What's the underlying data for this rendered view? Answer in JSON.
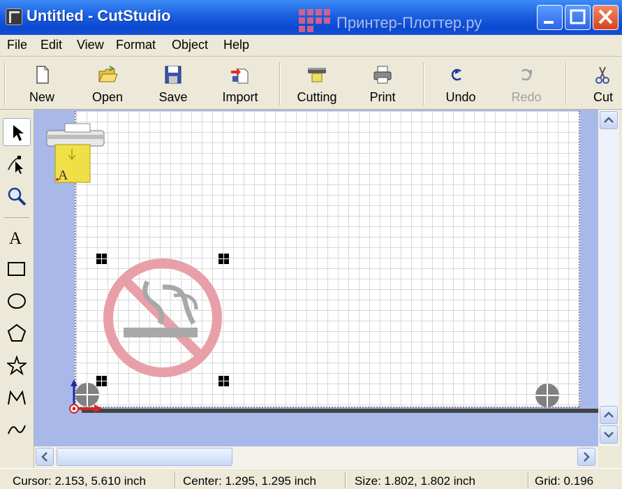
{
  "window": {
    "title": "Untitled - CutStudio"
  },
  "watermark": {
    "text": "Принтер-Плоттер.ру"
  },
  "menu": [
    {
      "label": "File"
    },
    {
      "label": "Edit"
    },
    {
      "label": "View"
    },
    {
      "label": "Format"
    },
    {
      "label": "Object"
    },
    {
      "label": "Help"
    }
  ],
  "toolbar": {
    "new": "New",
    "open": "Open",
    "save": "Save",
    "import": "Import",
    "cutting": "Cutting",
    "print": "Print",
    "undo": "Undo",
    "redo": "Redo",
    "cut": "Cut"
  },
  "tools": [
    "select-arrow",
    "node-edit",
    "zoom",
    "text",
    "rectangle",
    "ellipse",
    "polygon",
    "star",
    "polyline",
    "freehand"
  ],
  "tool_text_glyph": "A",
  "printer_label": "A",
  "status": {
    "cursor": "Cursor: 2.153, 5.610 inch",
    "center": "Center: 1.295, 1.295 inch",
    "size": "Size: 1.802, 1.802 inch",
    "grid": "Grid: 0.196"
  },
  "colors": {
    "titlebar": "#1b5fe0",
    "accent_red": "#e87888",
    "canvas_bg": "#a8b8e8"
  }
}
